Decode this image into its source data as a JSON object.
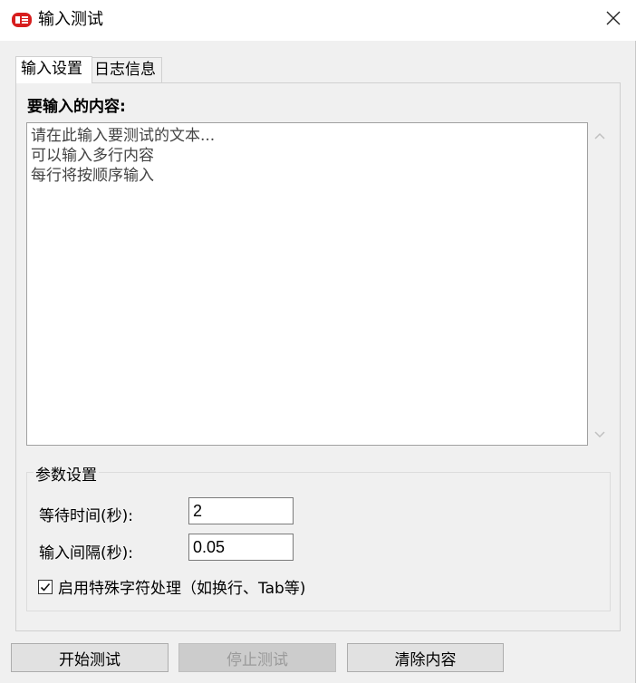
{
  "window": {
    "title": "输入测试",
    "app_icon": "toutiao-logo-icon",
    "close_icon": "close-icon"
  },
  "tabs": [
    {
      "label": "输入设置",
      "active": true
    },
    {
      "label": "日志信息",
      "active": false
    }
  ],
  "input_panel": {
    "content_label": "要输入的内容:",
    "textarea_value": "请在此输入要测试的文本...\n可以输入多行内容\n每行将按顺序输入"
  },
  "params": {
    "group_title": "参数设置",
    "wait_label": "等待时间(秒):",
    "wait_value": "2",
    "interval_label": "输入间隔(秒):",
    "interval_value": "0.05",
    "special_chars_label": "启用特殊字符处理（如换行、Tab等)",
    "special_chars_checked": true
  },
  "buttons": {
    "start": "开始测试",
    "stop": "停止测试",
    "clear": "清除内容"
  },
  "colors": {
    "window_bg": "#f0f0f0",
    "disabled_text": "#9a9a9a",
    "icon_red": "#d71e1e"
  }
}
